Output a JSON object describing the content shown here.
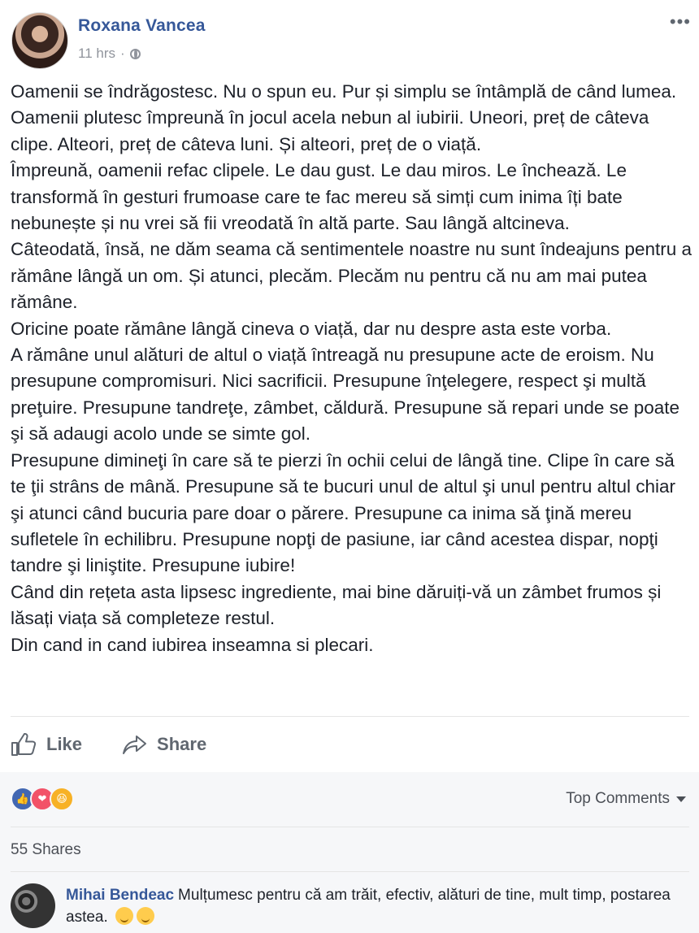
{
  "post": {
    "author": "Roxana Vancea",
    "time": "11 hrs",
    "separator": "·",
    "more": "•••",
    "paragraphs": [
      "Oamenii se îndrăgostesc. Nu o spun eu. Pur și simplu se întâmplă de când lumea.",
      "Oamenii plutesc împreună în jocul acela nebun al iubirii. Uneori, preț de câteva clipe. Alteori, preț de câteva luni. Și alteori, preț de o viață.",
      "Împreună, oamenii refac clipele. Le dau gust. Le dau miros. Le închează. Le transformă în gesturi frumoase care te fac mereu să simți cum inima îți bate nebunește și nu vrei să fii vreodată în altă parte. Sau lângă altcineva.",
      "Câteodată, însă, ne dăm seama că sentimentele noastre nu sunt îndeajuns pentru a rămâne lângă un om. Și atunci, plecăm. Plecăm nu pentru că nu am mai putea rămâne.",
      "Oricine poate rămâne lângă cineva o viață, dar nu despre asta este vorba.",
      "A rămâne unul alături de altul o viață întreagă nu presupune acte de eroism. Nu presupune compromisuri. Nici sacrificii. Presupune înţelegere, respect şi multă preţuire. Presupune tandreţe, zâmbet, căldură. Presupune să repari unde se poate şi să adaugi acolo unde se simte gol.",
      "Presupune dimineţi în care să te pierzi în ochii celui de lângă tine. Clipe în care să te ţii strâns de mână. Presupune să te bucuri unul de altul şi unul pentru altul chiar şi atunci când bucuria pare doar o părere. Presupune ca inima să ţină mereu sufletele în echilibru. Presupune nopţi de pasiune, iar când acestea dispar, nopţi tandre şi liniştite. Presupune iubire!",
      "Când din rețeta asta lipsesc ingrediente, mai bine dăruiți-vă un zâmbet frumos și lăsați viața să completeze restul.",
      "Din cand in cand iubirea inseamna si plecari."
    ]
  },
  "actions": {
    "like": "Like",
    "share": "Share"
  },
  "reactions": {
    "like_icon": "👍",
    "love_icon": "❤",
    "haha_icon": "😆"
  },
  "top_comments": "Top Comments",
  "shares": "55 Shares",
  "comment": {
    "author": "Mihai Bendeac",
    "text": "Mulțumesc pentru că am trăit, efectiv, alături de tine, mult timp, postarea astea."
  }
}
